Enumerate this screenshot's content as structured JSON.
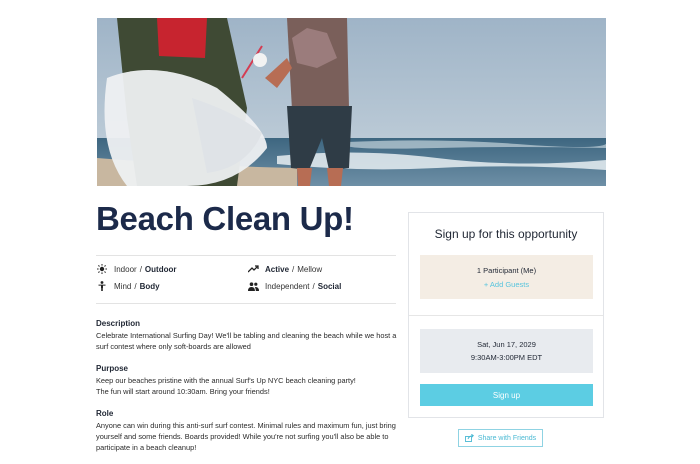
{
  "event": {
    "title": "Beach Clean Up!",
    "hero_image": "volunteers-picking-up-trash-on-beach"
  },
  "attributes": {
    "setting": {
      "icon": "sun-icon",
      "option1": "Indoor",
      "option2": "Outdoor",
      "selected": "Outdoor"
    },
    "activity": {
      "icon": "trending-icon",
      "option1": "Active",
      "option2": "Mellow",
      "selected": "Active"
    },
    "focus": {
      "icon": "person-icon",
      "option1": "Mind",
      "option2": "Body",
      "selected": "Body"
    },
    "group": {
      "icon": "people-icon",
      "option1": "Independent",
      "option2": "Social",
      "selected": "Social"
    },
    "separator": "/"
  },
  "sections": {
    "description": {
      "heading": "Description",
      "text": "Celebrate International Surfing Day! We'll be tabling and cleaning the beach while we host a surf contest where only soft-boards are allowed"
    },
    "purpose": {
      "heading": "Purpose",
      "line1": "Keep our beaches pristine with the annual Surf's Up NYC beach cleaning party!",
      "line2": "The fun will start around 10:30am. Bring your friends!"
    },
    "role": {
      "heading": "Role",
      "text": "Anyone can win during this anti-surf surf contest. Minimal rules and maximum fun, just bring yourself and some friends. Boards provided! While you're not surfing you'll also be able to participate in a beach cleanup!"
    }
  },
  "signup": {
    "title": "Sign up for this opportunity",
    "participants": "1 Participant (Me)",
    "add_guests": "+ Add Guests",
    "date": "Sat, Jun 17, 2029",
    "time": "9:30AM-3:00PM EDT",
    "button": "Sign up"
  },
  "share": {
    "label": "Share with Friends",
    "icon": "share-icon"
  },
  "colors": {
    "title": "#1c2a4a",
    "accent": "#5ccde3",
    "guests_bg": "#f4ede4",
    "date_bg": "#e8ebef"
  }
}
